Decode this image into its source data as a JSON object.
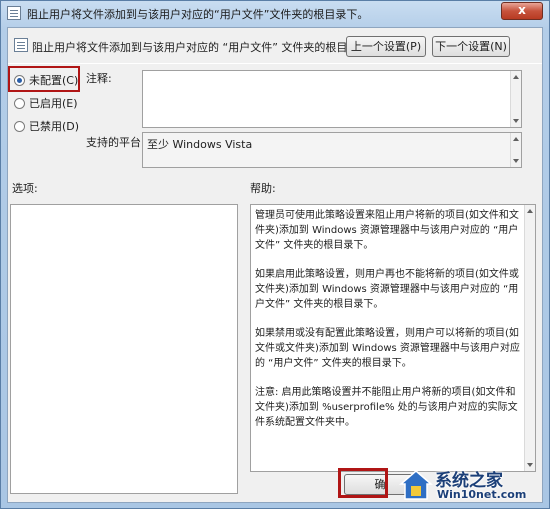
{
  "window": {
    "title": "阻止用户将文件添加到与该用户对应的“用户文件”文件夹的根目录下。",
    "close_symbol": "x"
  },
  "header": {
    "setting_name": "阻止用户将文件添加到与该用户对应的 “用户文件” 文件夹的根目录下。",
    "prev_button": "上一个设置(P)",
    "next_button": "下一个设置(N)"
  },
  "state": {
    "options": [
      {
        "label": "未配置(C)",
        "selected": true
      },
      {
        "label": "已启用(E)",
        "selected": false
      },
      {
        "label": "已禁用(D)",
        "selected": false
      }
    ]
  },
  "comment": {
    "label": "注释:",
    "value": ""
  },
  "platform": {
    "label": "支持的平台:",
    "value": "至少 Windows Vista"
  },
  "options_panel": {
    "label": "选项:"
  },
  "help_panel": {
    "label": "帮助:",
    "paragraphs": [
      "管理员可使用此策略设置来阻止用户将新的项目(如文件和文件夹)添加到 Windows 资源管理器中与该用户对应的 “用户文件” 文件夹的根目录下。",
      "如果启用此策略设置，则用户再也不能将新的项目(如文件或文件夹)添加到 Windows 资源管理器中与该用户对应的 “用户文件” 文件夹的根目录下。",
      "如果禁用或没有配置此策略设置，则用户可以将新的项目(如文件或文件夹)添加到 Windows 资源管理器中与该用户对应的 “用户文件” 文件夹的根目录下。",
      "注意: 启用此策略设置并不能阻止用户将新的项目(如文件和文件夹)添加到 %userprofile% 处的与该用户对应的实际文件系统配置文件夹中。"
    ]
  },
  "footer": {
    "ok_button": "确"
  },
  "watermark": {
    "line1": "系统之家",
    "line2": "Win10net.com"
  }
}
